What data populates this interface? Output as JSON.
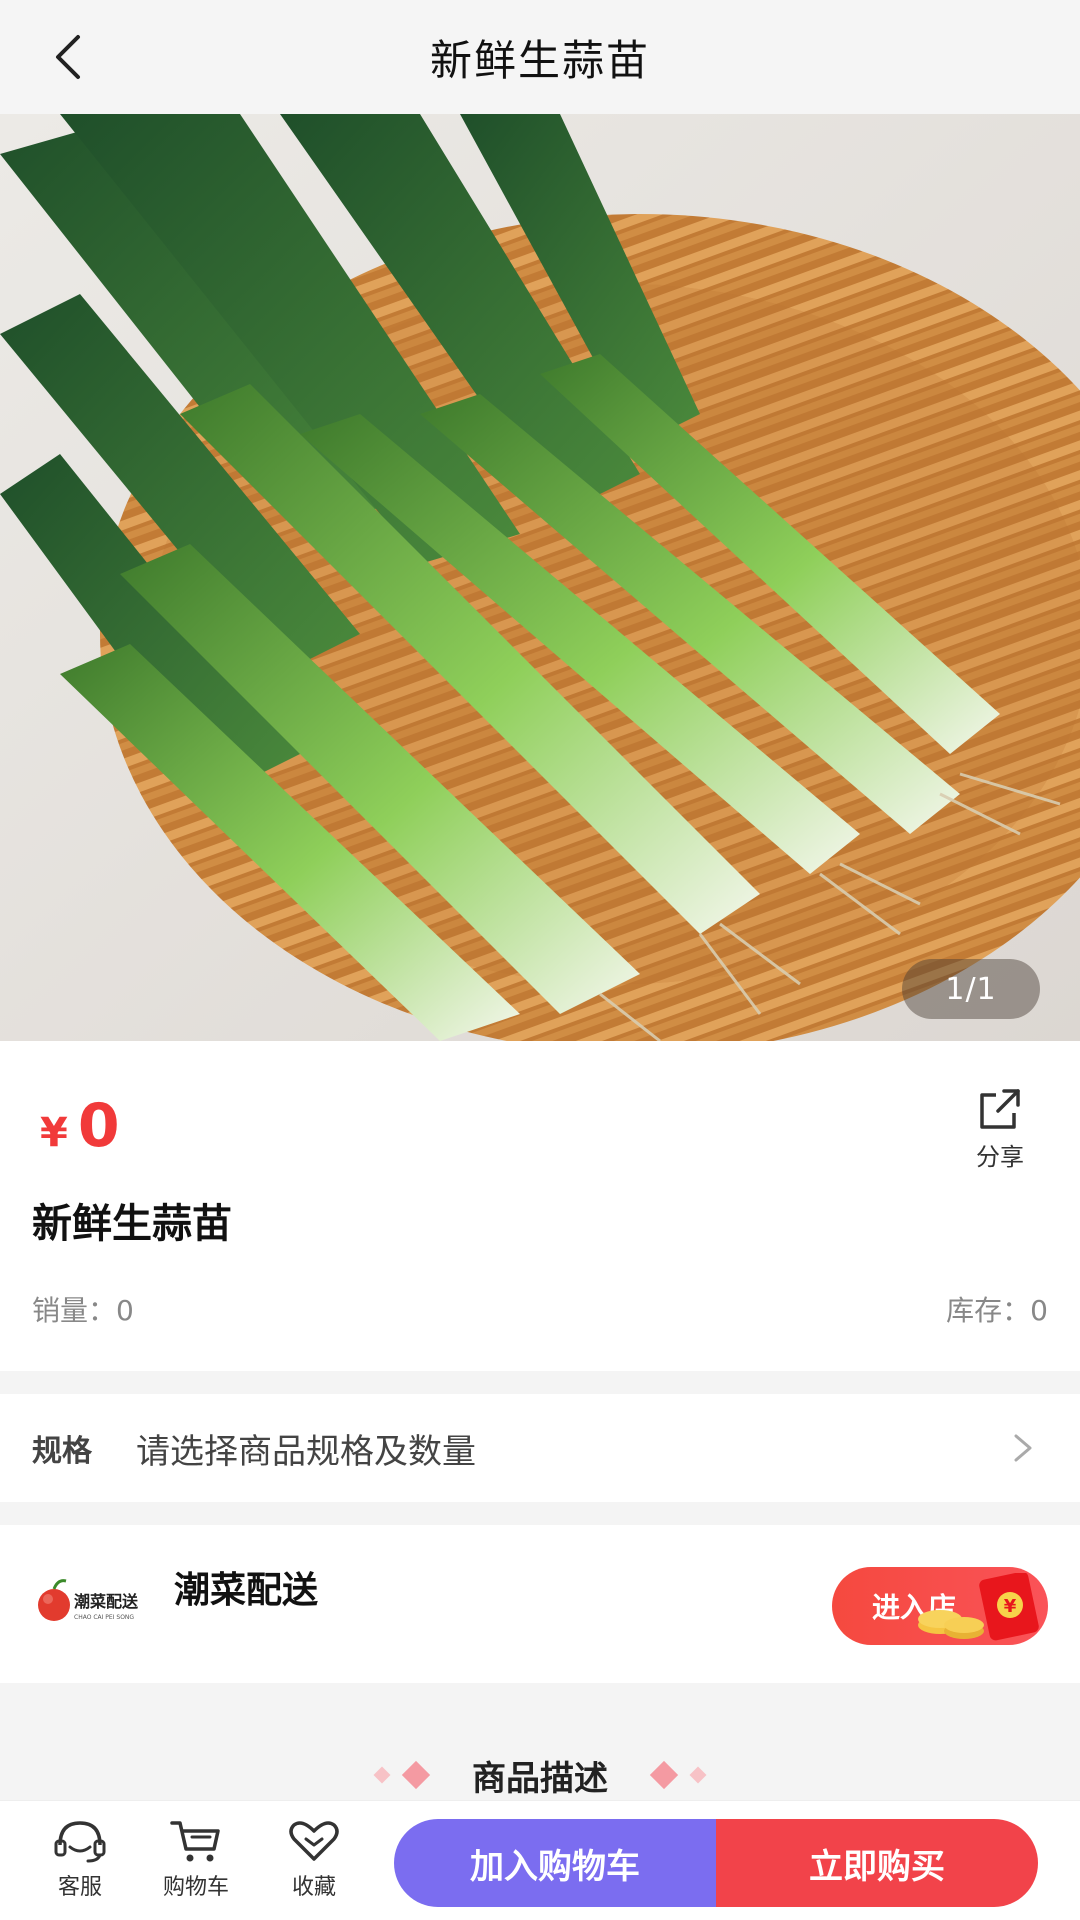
{
  "header": {
    "title": "新鲜生蒜苗",
    "back_icon": "chevron-left-icon"
  },
  "gallery": {
    "counter": "1/1",
    "image_subject": "fresh garlic sprouts in a wicker basket"
  },
  "product": {
    "currency": "¥",
    "price": "0",
    "name": "新鲜生蒜苗",
    "sales_label": "销量：0",
    "stock_label": "库存：0",
    "share_label": "分享",
    "share_icon": "share-icon"
  },
  "spec": {
    "label": "规格",
    "value": "请选择商品规格及数量",
    "arrow_icon": "chevron-right-icon"
  },
  "store": {
    "name": "潮菜配送",
    "logo_text": "潮菜配送",
    "logo_subtext": "CHAO CAI PEI SONG",
    "enter_label": "进入店",
    "red_packet_symbol": "¥"
  },
  "description": {
    "title": "商品描述"
  },
  "bottom_bar": {
    "service_label": "客服",
    "cart_label": "购物车",
    "favorite_label": "收藏",
    "add_to_cart": "加入购物车",
    "buy_now": "立即购买"
  },
  "colors": {
    "price_red": "#f13a3a",
    "cart_button": "#7b6df0",
    "buy_button": "#f2434a",
    "header_bg": "#f5f5f5"
  }
}
